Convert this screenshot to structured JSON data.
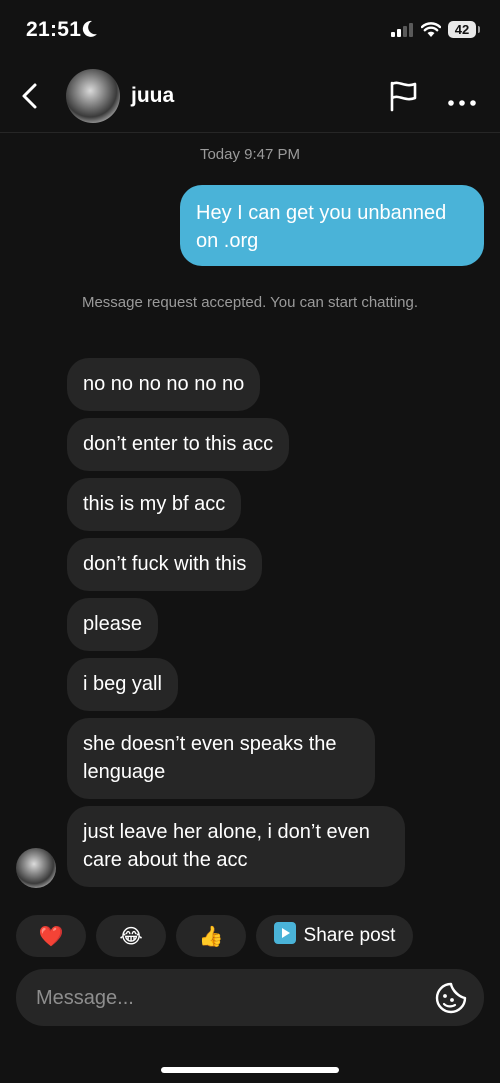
{
  "status_bar": {
    "time": "21:51",
    "battery": "42"
  },
  "header": {
    "username": "juua"
  },
  "chat": {
    "timestamp": "Today 9:47 PM",
    "outgoing": [
      {
        "text": "Hey I can get you unbanned on .org"
      }
    ],
    "system_message": "Message request accepted. You can start chatting.",
    "incoming": [
      {
        "text": "no no no no no no"
      },
      {
        "text": "don’t enter to this acc"
      },
      {
        "text": "this is my bf acc"
      },
      {
        "text": "don’t fuck with this"
      },
      {
        "text": "please"
      },
      {
        "text": "i beg yall"
      },
      {
        "text": "she doesn’t even speaks the lenguage"
      },
      {
        "text": "just leave her alone, i don’t even care about the acc"
      }
    ]
  },
  "quick_reactions": {
    "reactions": [
      "❤️",
      "😂",
      "👍"
    ],
    "share_post_label": "Share post",
    "colors": {
      "share_icon": "#4ab3d8"
    }
  },
  "composer": {
    "placeholder": "Message..."
  },
  "colors": {
    "outgoing_bubble": "#4ab3d8",
    "incoming_bubble": "#262626",
    "background": "#121212"
  }
}
